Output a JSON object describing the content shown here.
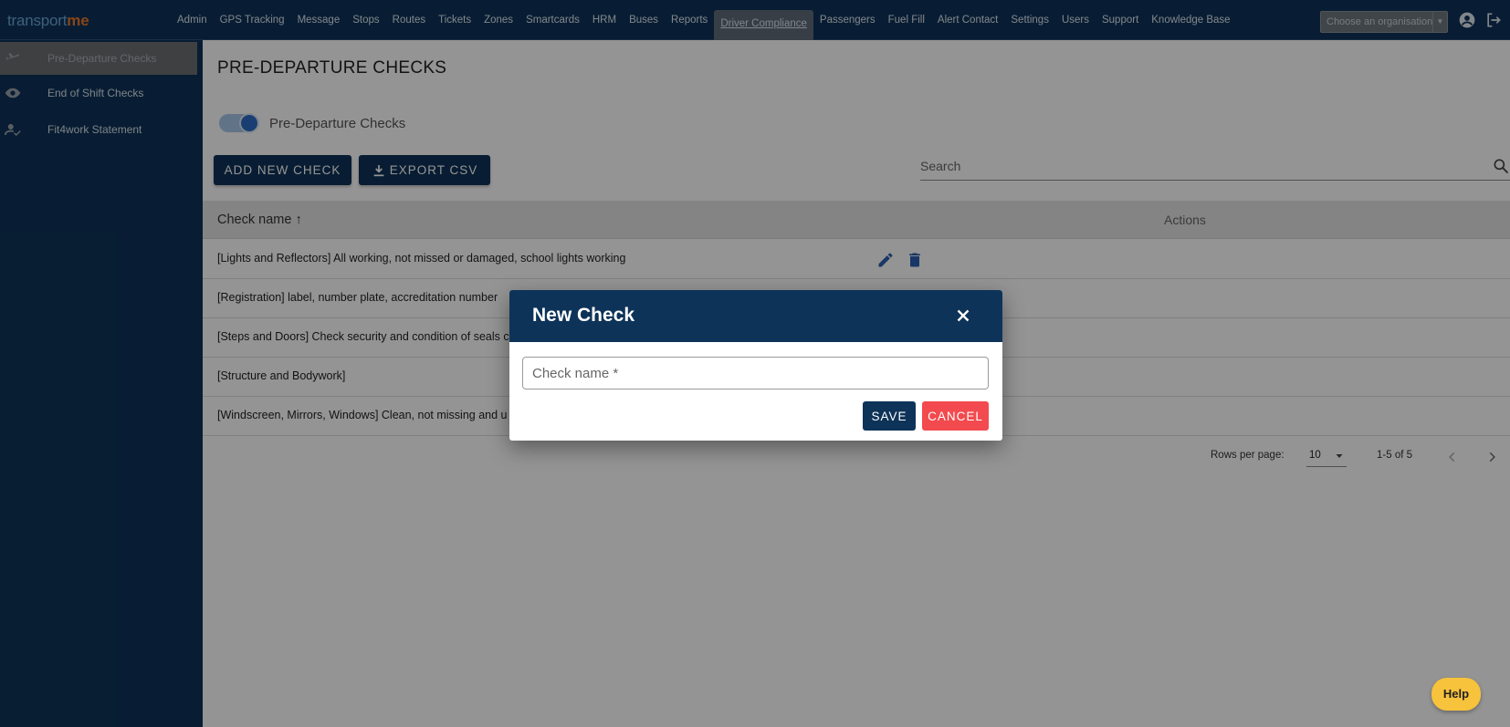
{
  "app": {
    "logo_part1": "transport",
    "logo_part2": "me"
  },
  "nav": {
    "items": [
      "Admin",
      "GPS Tracking",
      "Message",
      "Stops",
      "Routes",
      "Tickets",
      "Zones",
      "Smartcards",
      "HRM",
      "Buses",
      "Reports",
      "Driver Compliance",
      "Passengers",
      "Fuel Fill",
      "Alert Contact",
      "Settings",
      "Users",
      "Support",
      "Knowledge Base"
    ],
    "active": "Driver Compliance",
    "org_select_placeholder": "Choose an organisation"
  },
  "sidebar": {
    "items": [
      {
        "label": "Pre-Departure Checks",
        "icon": "airplane-icon",
        "active": true
      },
      {
        "label": "End of Shift Checks",
        "icon": "eye-icon",
        "active": false
      },
      {
        "label": "Fit4work Statement",
        "icon": "person-check-icon",
        "active": false
      }
    ]
  },
  "page": {
    "title": "PRE-DEPARTURE CHECKS",
    "toggle_label": "Pre-Departure Checks",
    "toggle_on": true,
    "add_button": "ADD NEW CHECK",
    "export_button": "EXPORT CSV",
    "search_placeholder": "Search"
  },
  "table": {
    "columns": [
      "Check name",
      "Actions"
    ],
    "rows": [
      "[Lights and Reflectors] All working, not missed or damaged, school lights working",
      "[Registration] label, number plate, accreditation number",
      "[Steps and Doors] Check security and condition of seals c",
      "[Structure and Bodywork]",
      "[Windscreen, Mirrors, Windows] Clean, not missing and u"
    ]
  },
  "pagination": {
    "rows_per_page_label": "Rows per page:",
    "rows_per_page": "10",
    "range": "1-5 of 5"
  },
  "help": "Help",
  "dialog": {
    "title": "New Check",
    "field_placeholder": "Check name *",
    "field_value": "",
    "save": "SAVE",
    "cancel": "CANCEL"
  },
  "colors": {
    "primary": "#0e3358",
    "cancel": "#f24a4e",
    "help": "#f7c23c",
    "action_icon": "#2b5fb0"
  }
}
